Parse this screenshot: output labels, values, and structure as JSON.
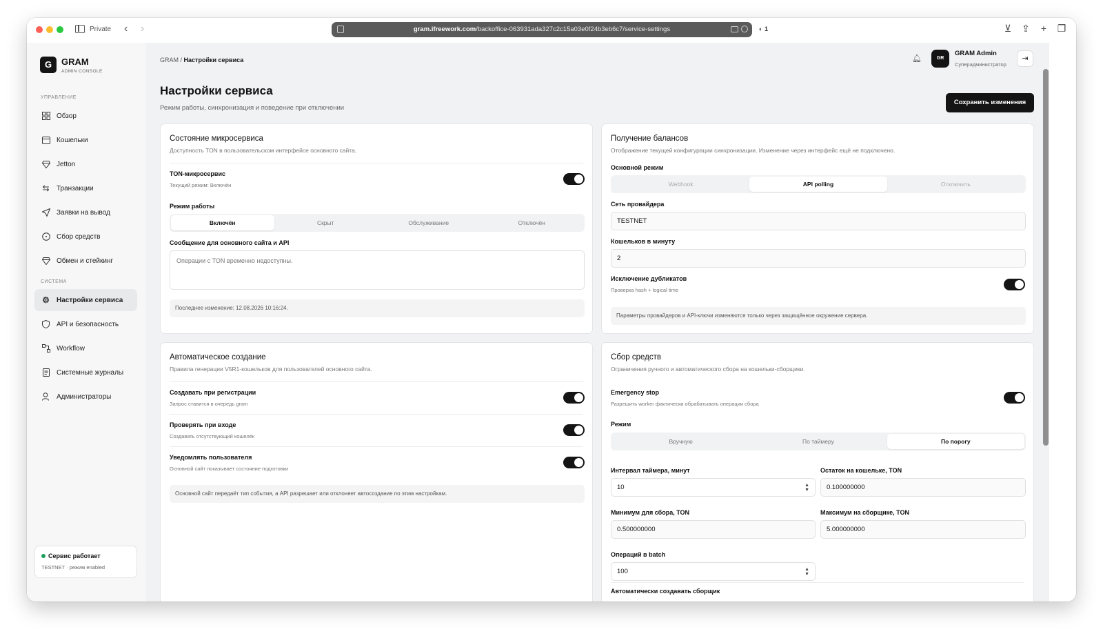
{
  "browser": {
    "private_label": "Private",
    "url_domain": "gram.ifreework.com",
    "url_path": "/backoffice-063931ada327c2c15a03e0f24b3eb6c7/service-settings",
    "shield_count": "1"
  },
  "sidebar": {
    "logo_letter": "G",
    "brand_name": "GRAM",
    "brand_sub": "ADMIN CONSOLE",
    "section_manage": "УПРАВЛЕНИЕ",
    "section_system": "СИСТЕМА",
    "items": [
      {
        "label": "Обзор",
        "icon": "grid-icon"
      },
      {
        "label": "Кошельки",
        "icon": "wallet-icon"
      },
      {
        "label": "Jetton",
        "icon": "diamond-icon"
      },
      {
        "label": "Транзакции",
        "icon": "arrows-icon"
      },
      {
        "label": "Заявки на вывод",
        "icon": "send-icon"
      },
      {
        "label": "Сбор средств",
        "icon": "coin-icon"
      },
      {
        "label": "Обмен и стейкинг",
        "icon": "gem-icon"
      }
    ],
    "system_items": [
      {
        "label": "Настройки сервиса",
        "icon": "gear-icon",
        "active": true
      },
      {
        "label": "API и безопасность",
        "icon": "shield-icon"
      },
      {
        "label": "Workflow",
        "icon": "workflow-icon"
      },
      {
        "label": "Системные журналы",
        "icon": "document-icon"
      },
      {
        "label": "Администраторы",
        "icon": "users-icon"
      }
    ],
    "status_title": "Сервис работает",
    "status_sub": "TESTNET · режим enabled",
    "status_color": "#1b9e5a"
  },
  "header": {
    "breadcrumb_root": "GRAM",
    "breadcrumb_sep": "/",
    "breadcrumb_current": "Настройки сервиса",
    "avatar": "GR",
    "admin_name": "GRAM Admin",
    "admin_role": "Суперадминистратор"
  },
  "page": {
    "title": "Настройки сервиса",
    "subtitle": "Режим работы, синхронизация и поведение при отключении",
    "save_label": "Сохранить изменения"
  },
  "microservice": {
    "title": "Состояние микросервиса",
    "desc": "Доступность TON в пользовательском интерфейсе основного сайта.",
    "toggle_label": "TON-микросервис",
    "toggle_hint": "Текущий режим: Включён",
    "toggle_on": true,
    "mode_label": "Режим работы",
    "modes": [
      "Включён",
      "Скрыт",
      "Обслуживание",
      "Отключён"
    ],
    "mode_selected": "Включён",
    "message_label": "Сообщение для основного сайта и API",
    "message_placeholder": "Операции с TON временно недоступны.",
    "last_change": "Последнее изменение: 12.08.2026 10:16:24."
  },
  "balances": {
    "title": "Получение балансов",
    "desc": "Отображение текущей конфигурации синхронизации. Изменение через интерфейс ещё не подключено.",
    "mode_label": "Основной режим",
    "modes": [
      "Webhook",
      "API polling",
      "Отключить"
    ],
    "mode_selected": "API polling",
    "network_label": "Сеть провайдера",
    "network_value": "TESTNET",
    "wpm_label": "Кошельков в минуту",
    "wpm_value": "2",
    "dedup_label": "Исключение дубликатов",
    "dedup_hint": "Проверка hash + logical time",
    "dedup_on": true,
    "note": "Параметры провайдеров и API-ключи изменяются только через защищённое окружение сервера."
  },
  "autocreate": {
    "title": "Автоматическое создание",
    "desc": "Правила генерации V5R1-кошельков для пользователей основного сайта.",
    "rows": [
      {
        "label": "Создавать при регистрации",
        "hint": "Запрос ставится в очередь gram",
        "on": true
      },
      {
        "label": "Проверять при входе",
        "hint": "Создавать отсутствующий кошелёк",
        "on": true
      },
      {
        "label": "Уведомлять пользователя",
        "hint": "Основной сайт показывает состояние подготовки",
        "on": true
      }
    ],
    "note": "Основной сайт передаёт тип события, а API разрешает или отклоняет автосоздание по этим настройкам."
  },
  "collection": {
    "title": "Сбор средств",
    "desc": "Ограничения ручного и автоматического сбора на кошельки-сборщики.",
    "estop_label": "Emergency stop",
    "estop_hint": "Разрешить worker фактически обрабатывать операции сбора",
    "estop_on": true,
    "mode_label": "Режим",
    "modes": [
      "Вручную",
      "По таймеру",
      "По порогу"
    ],
    "mode_selected": "По порогу",
    "interval_label": "Интервал таймера, минут",
    "interval_value": "10",
    "remainder_label": "Остаток на кошельке, TON",
    "remainder_value": "0.100000000",
    "min_label": "Минимум для сбора, TON",
    "min_value": "0.500000000",
    "max_label": "Максимум на сборщике, TON",
    "max_value": "5.000000000",
    "batch_label": "Операций в batch",
    "batch_value": "100",
    "auto_label": "Автоматически создавать сборщик"
  }
}
